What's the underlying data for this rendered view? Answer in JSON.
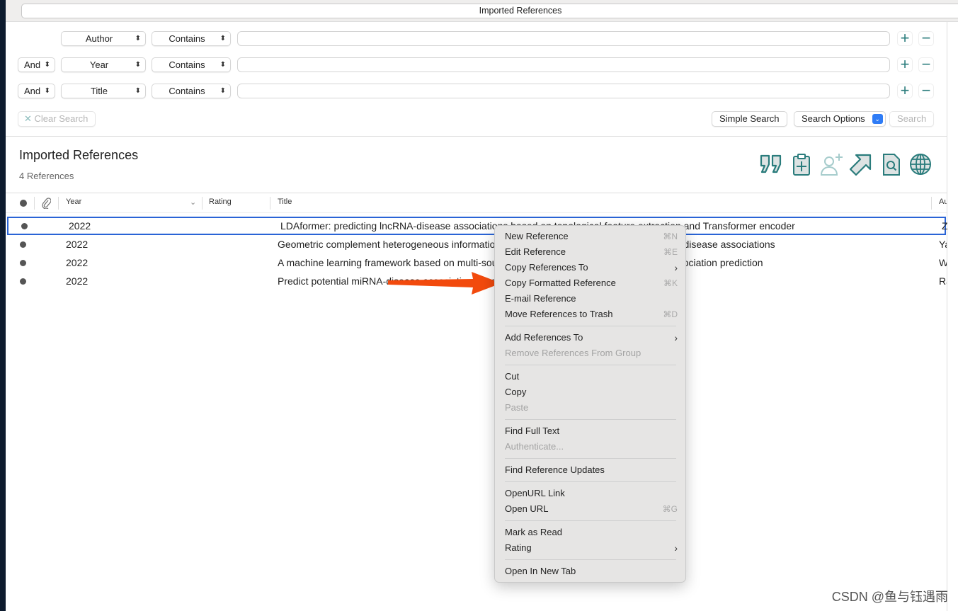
{
  "window": {
    "top_search_value": "Imported References"
  },
  "search": {
    "rows": [
      {
        "bool": "",
        "field": "Author",
        "op": "Contains",
        "value": ""
      },
      {
        "bool": "And",
        "field": "Year",
        "op": "Contains",
        "value": ""
      },
      {
        "bool": "And",
        "field": "Title",
        "op": "Contains",
        "value": ""
      }
    ],
    "clear_label": "Clear Search",
    "simple_label": "Simple Search",
    "options_label": "Search Options",
    "search_label": "Search"
  },
  "group": {
    "title": "Imported References",
    "count": "4 References"
  },
  "toolbar": {
    "icons": [
      "quote-icon",
      "clipboard-add-icon",
      "add-person-icon",
      "share-arrow-icon",
      "find-pdf-icon",
      "globe-icon"
    ],
    "accent": "#2a7c7c"
  },
  "table": {
    "headers": {
      "year": "Year",
      "rating": "Rating",
      "title": "Title",
      "author": "Au"
    },
    "rows": [
      {
        "year": "2022",
        "title": "LDAformer: predicting lncRNA-disease associations based on topological feature extraction and Transformer encoder",
        "author": "Z"
      },
      {
        "year": "2022",
        "title": "Geometric complement heterogeneous information and random forest for predicting lncRNA-disease associations",
        "author": "Ya"
      },
      {
        "year": "2022",
        "title": "A machine learning framework based on multi-source feature fusion for circRNA-disease association prediction",
        "author": "W"
      },
      {
        "year": "2022",
        "title": "Predict potential miRNA-disease associations based on bounded nuclear norm regularization",
        "author": "Ra"
      }
    ]
  },
  "context_menu": {
    "groups": [
      [
        {
          "label": "New Reference",
          "shortcut": "⌘N"
        },
        {
          "label": "Edit Reference",
          "shortcut": "⌘E"
        },
        {
          "label": "Copy References To",
          "submenu": true
        },
        {
          "label": "Copy Formatted Reference",
          "shortcut": "⌘K"
        },
        {
          "label": "E-mail Reference"
        },
        {
          "label": "Move References to Trash",
          "shortcut": "⌘D"
        }
      ],
      [
        {
          "label": "Add References To",
          "submenu": true
        },
        {
          "label": "Remove References From Group",
          "disabled": true
        }
      ],
      [
        {
          "label": "Cut"
        },
        {
          "label": "Copy"
        },
        {
          "label": "Paste",
          "disabled": true
        }
      ],
      [
        {
          "label": "Find Full Text"
        },
        {
          "label": "Authenticate...",
          "disabled": true
        }
      ],
      [
        {
          "label": "Find Reference Updates"
        }
      ],
      [
        {
          "label": "OpenURL Link"
        },
        {
          "label": "Open URL",
          "shortcut": "⌘G"
        }
      ],
      [
        {
          "label": "Mark as Read"
        },
        {
          "label": "Rating",
          "submenu": true
        }
      ],
      [
        {
          "label": "Open In New Tab"
        }
      ]
    ]
  },
  "annotation": {
    "arrow_color": "#f24a0d"
  },
  "watermark": "CSDN @鱼与钰遇雨"
}
